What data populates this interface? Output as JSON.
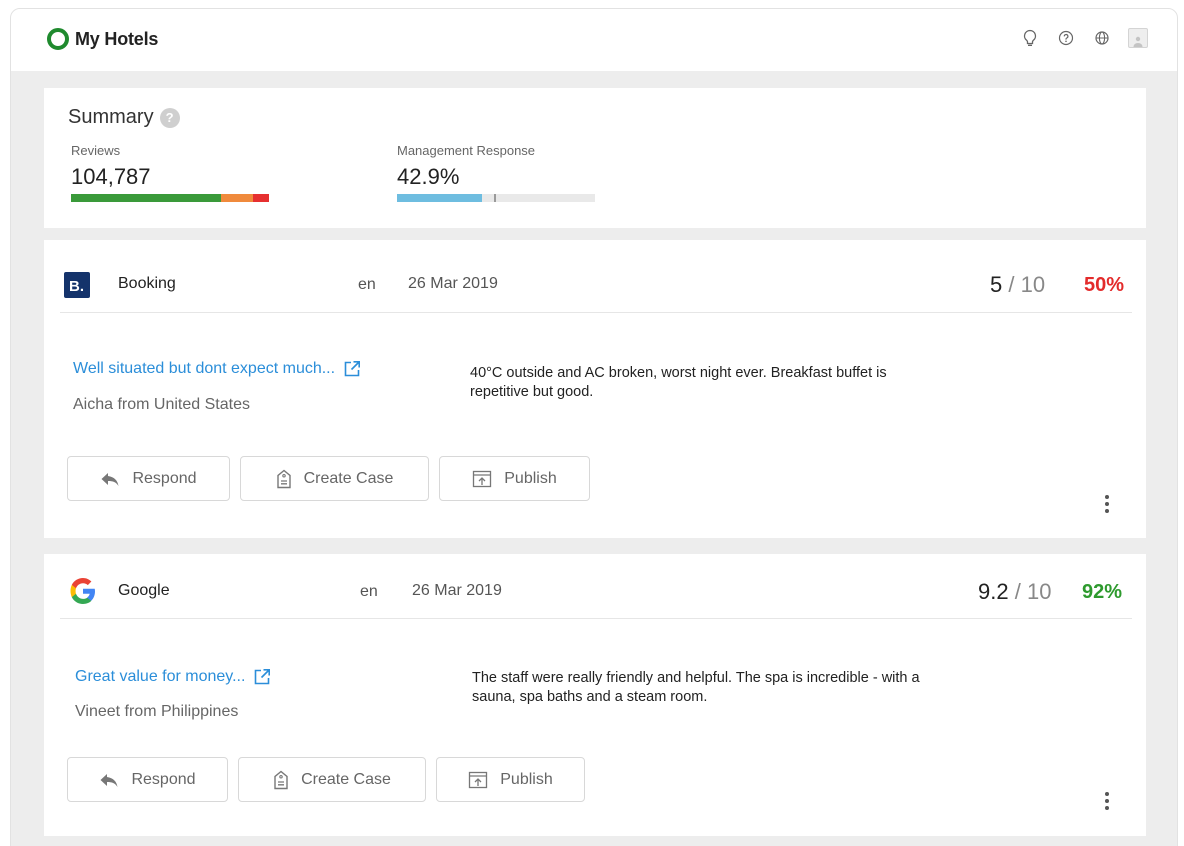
{
  "app": {
    "title": "My Hotels",
    "brand_color": "#1f8a2e"
  },
  "topbar": {
    "icons": [
      "lightbulb-icon",
      "help-icon",
      "globe-icon",
      "user-avatar-icon"
    ]
  },
  "summary": {
    "title": "Summary",
    "help_icon": "?",
    "reviews": {
      "label": "Reviews",
      "value": "104,787",
      "distribution": [
        {
          "color": "#3a9a3a",
          "share": 0.76
        },
        {
          "color": "#f08a3c",
          "share": 0.16
        },
        {
          "color": "#e63030",
          "share": 0.08
        }
      ]
    },
    "management_response": {
      "label": "Management Response",
      "value": "42.9%",
      "fill": 0.429,
      "fill_color": "#6ebde0"
    }
  },
  "reviews": [
    {
      "source": "Booking",
      "logo_text": "B.",
      "lang": "en",
      "date": "26 Mar 2019",
      "score": "5",
      "score_sep": "/",
      "score_max": "10",
      "percent": "50%",
      "percent_color": "#e32b2b",
      "title": "Well situated but dont expect much...",
      "author": "Aicha from United States",
      "text": "40°C outside and AC broken, worst night ever. Breakfast buffet is repetitive but good.",
      "actions": {
        "respond": "Respond",
        "create_case": "Create Case",
        "publish": "Publish"
      }
    },
    {
      "source": "Google",
      "logo_text": "G",
      "lang": "en",
      "date": "26 Mar 2019",
      "score": "9.2",
      "score_sep": "/",
      "score_max": "10",
      "percent": "92%",
      "percent_color": "#2e9a2e",
      "title": "Great value for money...",
      "author": "Vineet from Philippines",
      "text": "The staff were really friendly and helpful. The spa is incredible - with a sauna, spa baths and a steam room.",
      "actions": {
        "respond": "Respond",
        "create_case": "Create Case",
        "publish": "Publish"
      }
    }
  ]
}
